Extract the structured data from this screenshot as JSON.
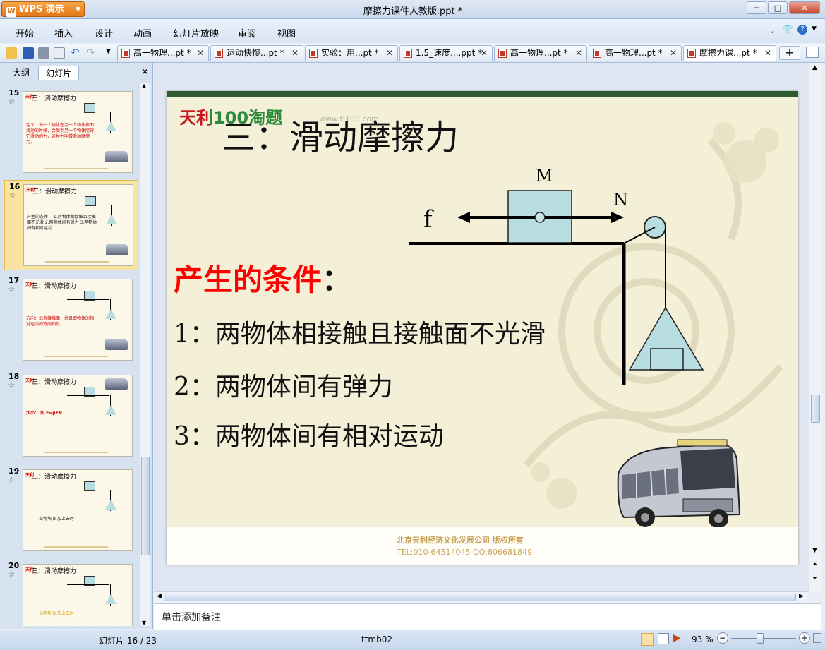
{
  "app": {
    "name": "WPS 演示",
    "document_title": "摩擦力课件人教版.ppt *"
  },
  "menu": [
    "开始",
    "插入",
    "设计",
    "动画",
    "幻灯片放映",
    "审阅",
    "视图"
  ],
  "tabs": [
    {
      "label": "高一物理...pt *"
    },
    {
      "label": "运动快慢...pt *"
    },
    {
      "label": "实验：用...pt *"
    },
    {
      "label": "1.5_速度....ppt *"
    },
    {
      "label": "高一物理...pt *"
    },
    {
      "label": "高一物理...pt *"
    },
    {
      "label": "摩擦力课...pt *"
    }
  ],
  "panel": {
    "tab_outline": "大纲",
    "tab_slides": "幻灯片"
  },
  "thumbnails": [
    {
      "number": "15",
      "title": "三：滑动摩擦力",
      "body": "定义：当一个物体在另一个物体表面滑动的时候，会受到另一个物体阻碍它滑动的力，这种力叫做滑动摩擦力。"
    },
    {
      "number": "16",
      "title": "三：滑动摩擦力",
      "body": "产生的条件： 1.两物体相接触且接触面不光滑 2.两物体间有弹力 3.两物体间有相对运动"
    },
    {
      "number": "17",
      "title": "三：滑动摩擦力",
      "body": "方向：沿着接触面，并且跟物体的相对运动的方向相反。"
    },
    {
      "number": "18",
      "title": "三：滑动摩擦力",
      "body": "大小： 即 F=μFN"
    },
    {
      "number": "19",
      "title": "三：滑动摩擦力",
      "body": "当物块 B 加上去时"
    },
    {
      "number": "20",
      "title": "三：滑动摩擦力",
      "body": "当物块 B 加上去时"
    }
  ],
  "slide": {
    "logo": "天利100淘题",
    "logo_url": "www.tl100.com",
    "title": "三：滑动摩擦力",
    "diagram": {
      "label_m": "M",
      "label_n": "N",
      "label_f": "f"
    },
    "heading": "产生的条件",
    "heading_colon": "：",
    "items": [
      "1：两物体相接触且接触面不光滑",
      "2：两物体间有弹力",
      "3：两物体间有相对运动"
    ],
    "footer_company": "北京天利经济文化发展公司 版权所有",
    "footer_contact": "TEL:010-64514045   QQ:806681849"
  },
  "notes_placeholder": "单击添加备注",
  "status": {
    "slide_info": "幻灯片 16 / 23",
    "template": "ttmb02",
    "zoom": "93 %"
  },
  "colors": {
    "accent": "#e2781a",
    "heading_red": "#ff0000",
    "slide_bg": "#f4f0d8"
  }
}
